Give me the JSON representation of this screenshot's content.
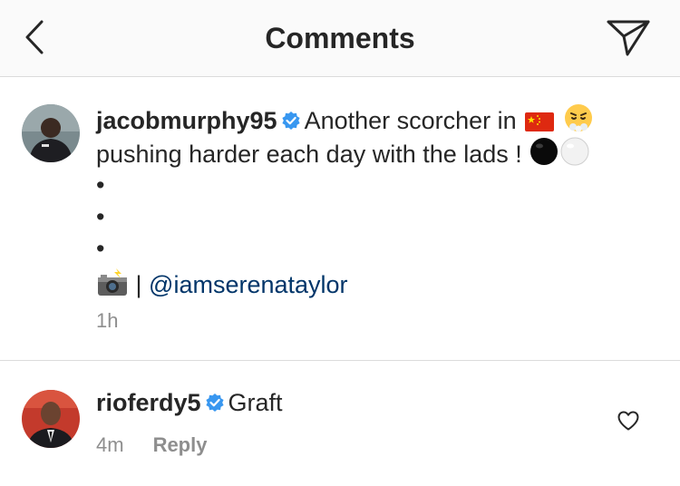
{
  "header": {
    "title": "Comments",
    "back_icon": "chevron-left-icon",
    "send_icon": "paper-plane-icon"
  },
  "caption": {
    "username": "jacobmurphy95",
    "text_part1": "Another scorcher in",
    "text_part2": "pushing harder each day with the lads !",
    "bullets": [
      "•",
      "•",
      "•"
    ],
    "separator": "|",
    "mention": "@iamserenataylor",
    "time": "1h"
  },
  "comment": {
    "username": "rioferdy5",
    "text": "Graft",
    "time": "4m",
    "reply_label": "Reply"
  },
  "colors": {
    "verified": "#3897f0",
    "mention": "#003569",
    "meta": "#8e8e8e",
    "divider": "#dbdbdb"
  }
}
